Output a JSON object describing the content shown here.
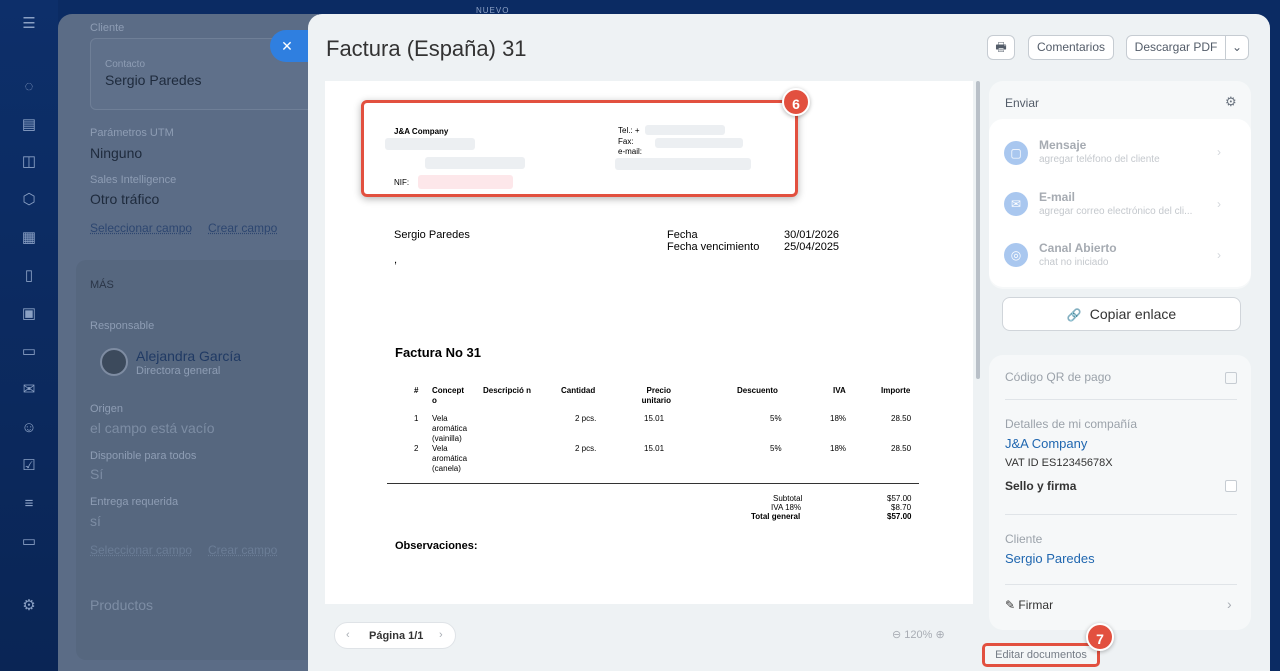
{
  "background": {
    "top_note": "NUEVO",
    "client_label": "Cliente",
    "contact_label": "Contacto",
    "contact_name": "Sergio Paredes",
    "utm_label": "Parámetros UTM",
    "utm_value": "Ninguno",
    "sales_label": "Sales Intelligence",
    "sales_value": "Otro tráfico",
    "select_field": "Seleccionar campo",
    "create_field": "Crear campo",
    "more_label": "MÁS",
    "responsible_label": "Responsable",
    "responsible_name": "Alejandra García",
    "responsible_role": "Directora general",
    "origin_label": "Origen",
    "origin_value": "el campo está vacío",
    "available_label": "Disponible para todos",
    "available_value": "Sí",
    "delivery_label": "Entrega requerida",
    "delivery_value": "sí",
    "products_label": "Productos"
  },
  "header": {
    "title": "Factura (España) 31",
    "comments": "Comentarios",
    "download": "Descargar PDF"
  },
  "document": {
    "company": "J&A Company",
    "tel": "Tel.: +",
    "fax": "Fax:",
    "email": "e-mail:",
    "nif": "NIF:",
    "client": "Sergio Paredes",
    "client_extra": ",",
    "date_label": "Fecha",
    "date_value": "30/01/2026",
    "due_label": "Fecha vencimiento",
    "due_value": "25/04/2025",
    "invoice_title": "Factura No 31",
    "columns": [
      "#",
      "Concept o",
      "Descripció n",
      "Cantidad",
      "Precio unitario",
      "Descuento",
      "IVA",
      "Importe"
    ],
    "rows": [
      {
        "n": "1",
        "concept": "Vela aromática (vainilla)",
        "qty": "2 pcs.",
        "price": "15.01",
        "disc": "5%",
        "iva": "18%",
        "amount": "28.50"
      },
      {
        "n": "2",
        "concept": "Vela aromática (canela)",
        "qty": "2 pcs.",
        "price": "15.01",
        "disc": "5%",
        "iva": "18%",
        "amount": "28.50"
      }
    ],
    "subtotal_label": "Subtotal",
    "subtotal_value": "$57.00",
    "iva_label": "IVA 18%",
    "iva_value": "$8.70",
    "total_label": "Total general",
    "total_value": "$57.00",
    "notes": "Observaciones:"
  },
  "markers": {
    "m6": "6",
    "m7": "7"
  },
  "pager": {
    "label": "Página 1/1",
    "zoom": "120%"
  },
  "send": {
    "title": "Enviar",
    "channels": [
      {
        "name": "Mensaje",
        "sub": "agregar teléfono del cliente"
      },
      {
        "name": "E-mail",
        "sub": "agregar correo electrónico del cli..."
      },
      {
        "name": "Canal Abierto",
        "sub": "chat no iniciado"
      }
    ],
    "copy_link": "Copiar enlace"
  },
  "info": {
    "qr_label": "Código QR de pago",
    "company_details_label": "Detalles de mi compañía",
    "company_name": "J&A Company",
    "vat": "VAT ID ES12345678X",
    "seal": "Sello y firma",
    "client_label": "Cliente",
    "client_name": "Sergio Paredes",
    "sign": "Firmar"
  },
  "edit_docs": "Editar documentos"
}
